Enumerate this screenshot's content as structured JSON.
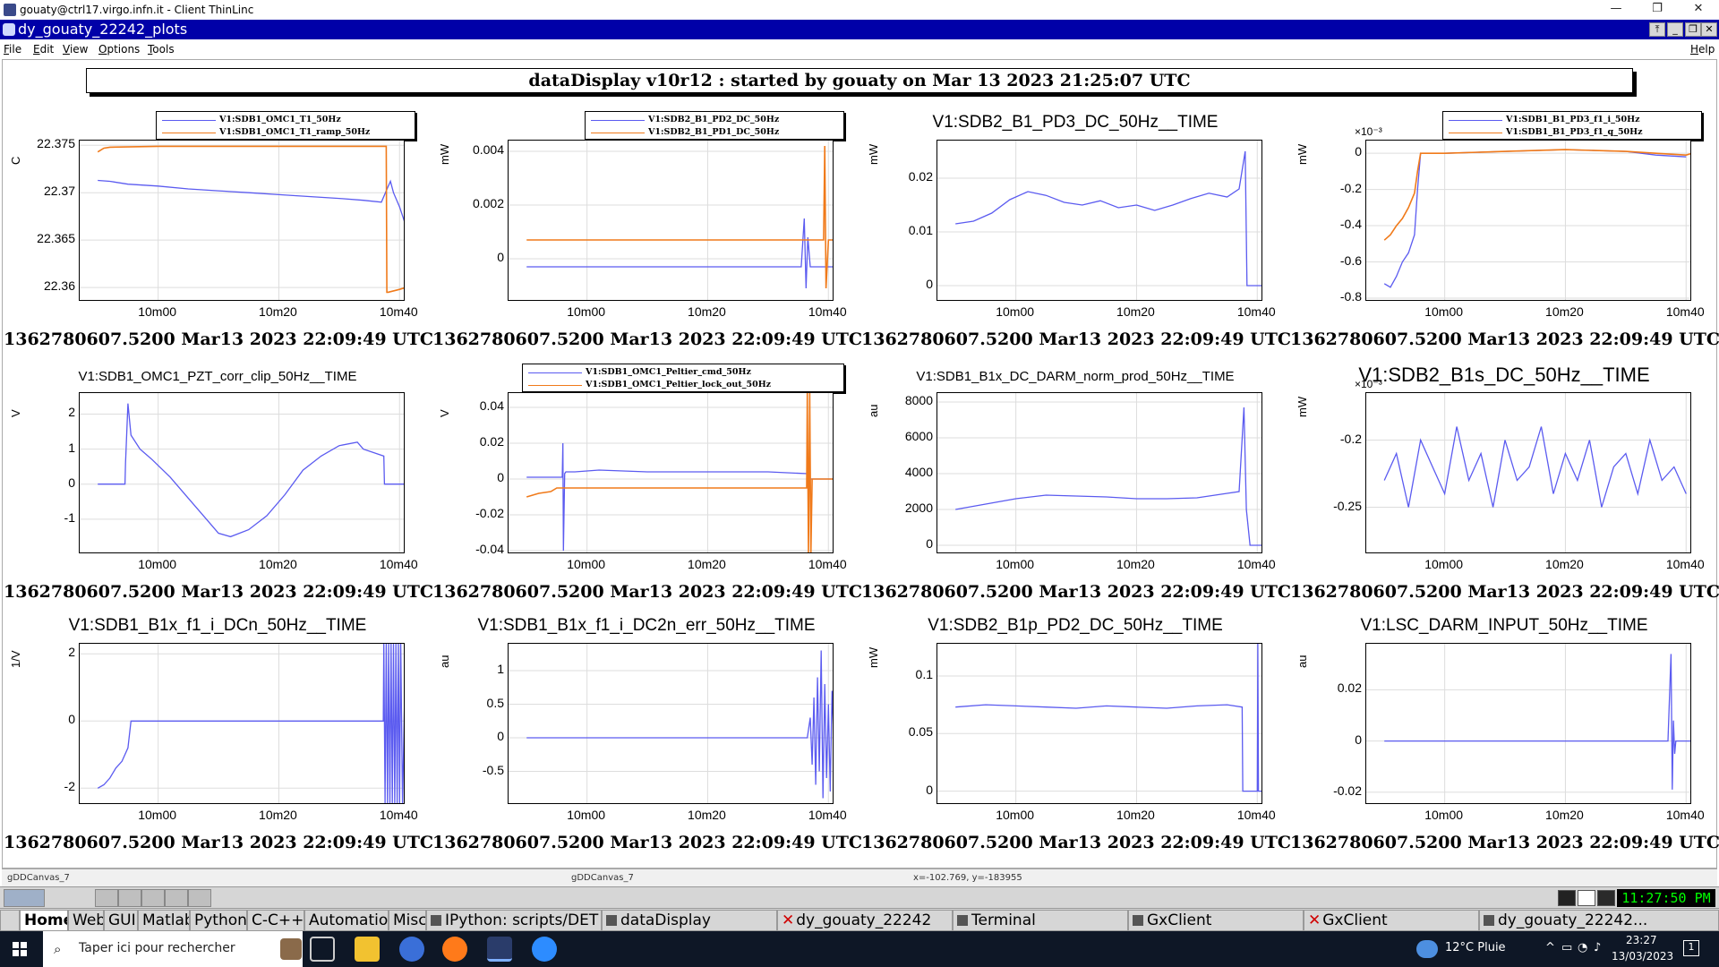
{
  "window": {
    "os_title": "gouaty@ctrl17.virgo.infn.it - Client ThinLinc",
    "app_title": "dy_gouaty_22242_plots",
    "minimize_label": "—",
    "restore_label": "❐",
    "close_label": "✕"
  },
  "menubar": {
    "file": "File",
    "edit": "Edit",
    "view": "View",
    "options": "Options",
    "tools": "Tools",
    "help": "Help"
  },
  "header": "dataDisplay v10r12 : started by gouaty on Mar 13 2023 21:25:07 UTC",
  "timestamp": "1362780607.5200 Mar13 2023 22:09:49 UTC",
  "x_ticks": [
    "10m00",
    "10m20",
    "10m40"
  ],
  "colors": {
    "blue": "#5b5bf0",
    "orange": "#f07a1a"
  },
  "chart_data": [
    {
      "type": "line",
      "legend": [
        "V1:SDB1_OMC1_T1_50Hz",
        "V1:SDB1_OMC1_T1_ramp_50Hz"
      ],
      "ylabel": "C",
      "ylim": [
        22.3585,
        22.3755
      ],
      "yticks": [
        "22.375",
        "22.37",
        "22.365",
        "22.36"
      ],
      "ytick_values": [
        22.375,
        22.37,
        22.365,
        22.36
      ],
      "series": [
        {
          "name": "V1:SDB1_OMC1_T1_50Hz",
          "color": "blue",
          "x": [
            0,
            2,
            5,
            10,
            15,
            20,
            25,
            30,
            35,
            40,
            44,
            47,
            48,
            48.5,
            49,
            50,
            51
          ],
          "y": [
            22.3713,
            22.3712,
            22.3709,
            22.3707,
            22.3704,
            22.3702,
            22.37,
            22.3698,
            22.3696,
            22.3694,
            22.3692,
            22.369,
            22.3705,
            22.3712,
            22.37,
            22.3685,
            22.3666
          ]
        },
        {
          "name": "V1:SDB1_OMC1_T1_ramp_50Hz",
          "color": "orange",
          "x": [
            0,
            1,
            2,
            10,
            20,
            30,
            40,
            47.8,
            47.9,
            48.1,
            50,
            51
          ],
          "y": [
            22.3743,
            22.3747,
            22.3748,
            22.3749,
            22.3749,
            22.3749,
            22.3749,
            22.3749,
            22.3595,
            22.3595,
            22.3598,
            22.36
          ]
        }
      ]
    },
    {
      "type": "line",
      "legend": [
        "V1:SDB2_B1_PD2_DC_50Hz",
        "V1:SDB2_B1_PD1_DC_50Hz"
      ],
      "ylabel": "mW",
      "ylim": [
        -0.0016,
        0.0044
      ],
      "yticks": [
        "0.004",
        "0.002",
        "0"
      ],
      "ytick_values": [
        0.004,
        0.002,
        0
      ],
      "series": [
        {
          "name": "V1:SDB2_B1_PD2_DC_50Hz",
          "color": "blue",
          "x": [
            0,
            10,
            20,
            30,
            40,
            45.5,
            46,
            46.3,
            46.6,
            47,
            49,
            51
          ],
          "y": [
            -0.0003,
            -0.0003,
            -0.0003,
            -0.0003,
            -0.0003,
            -0.0003,
            0.0015,
            -0.0011,
            0.0008,
            -0.0003,
            -0.0003,
            -0.0003
          ]
        },
        {
          "name": "V1:SDB2_B1_PD1_DC_50Hz",
          "color": "orange",
          "x": [
            0,
            10,
            20,
            30,
            40,
            48,
            49.2,
            49.4,
            49.6,
            50,
            51
          ],
          "y": [
            0.0007,
            0.0007,
            0.0007,
            0.0007,
            0.0007,
            0.0007,
            0.0007,
            0.0042,
            -0.0011,
            0.0007,
            0.0007
          ]
        }
      ]
    },
    {
      "type": "line",
      "title": "V1:SDB2_B1_PD3_DC_50Hz__TIME",
      "ylabel": "mW",
      "ylim": [
        -0.003,
        0.027
      ],
      "yticks": [
        "0.02",
        "0.01",
        "0"
      ],
      "ytick_values": [
        0.02,
        0.01,
        0
      ],
      "series": [
        {
          "color": "blue",
          "x": [
            0,
            3,
            6,
            9,
            12,
            15,
            18,
            21,
            24,
            27,
            30,
            33,
            36,
            39,
            42,
            45,
            47,
            48,
            48.3,
            48.6,
            51
          ],
          "y": [
            0.0115,
            0.012,
            0.0135,
            0.016,
            0.0175,
            0.0168,
            0.0155,
            0.015,
            0.0158,
            0.0145,
            0.015,
            0.014,
            0.015,
            0.0162,
            0.0172,
            0.0165,
            0.018,
            0.025,
            0.0,
            0.0,
            0.0
          ]
        }
      ]
    },
    {
      "type": "line",
      "legend": [
        "V1:SDB1_B1_PD3_f1_i_50Hz",
        "V1:SDB1_B1_PD3_f1_q_50Hz"
      ],
      "ylabel": "mW",
      "exponent": "×10⁻³",
      "ylim": [
        -0.82,
        0.07
      ],
      "yticks": [
        "0",
        "-0.2",
        "-0.4",
        "-0.6",
        "-0.8"
      ],
      "ytick_values": [
        0,
        -0.2,
        -0.4,
        -0.6,
        -0.8
      ],
      "series": [
        {
          "name": "V1:SDB1_B1_PD3_f1_i_50Hz",
          "color": "blue",
          "x": [
            0,
            1,
            2,
            3,
            4,
            5,
            5.5,
            6,
            10,
            20,
            30,
            40,
            45,
            50
          ],
          "y": [
            -0.72,
            -0.74,
            -0.68,
            -0.6,
            -0.55,
            -0.45,
            -0.2,
            0.0,
            0.0,
            0.01,
            0.02,
            0.01,
            -0.01,
            -0.02
          ]
        },
        {
          "name": "V1:SDB1_B1_PD3_f1_q_50Hz",
          "color": "orange",
          "x": [
            0,
            1,
            2,
            3,
            4,
            5,
            5.5,
            6,
            10,
            20,
            30,
            40,
            45,
            50,
            51
          ],
          "y": [
            -0.48,
            -0.45,
            -0.4,
            -0.36,
            -0.3,
            -0.22,
            -0.1,
            0.0,
            0.0,
            0.01,
            0.02,
            0.01,
            0.0,
            -0.01,
            0.0
          ]
        }
      ]
    },
    {
      "type": "line",
      "title": "V1:SDB1_OMC1_PZT_corr_clip_50Hz__TIME",
      "ylabel": "V",
      "ylim": [
        -2.0,
        2.6
      ],
      "yticks": [
        "2",
        "1",
        "0",
        "-1"
      ],
      "ytick_values": [
        2,
        1,
        0,
        -1
      ],
      "series": [
        {
          "color": "blue",
          "x": [
            0,
            4.5,
            4.6,
            5,
            5.5,
            7,
            9,
            12,
            15,
            18,
            20,
            22,
            25,
            28,
            31,
            34,
            37,
            40,
            43,
            44,
            47.4,
            47.5,
            51
          ],
          "y": [
            0,
            0,
            0.6,
            2.3,
            1.4,
            1.0,
            0.7,
            0.2,
            -0.4,
            -1.0,
            -1.4,
            -1.5,
            -1.3,
            -0.9,
            -0.3,
            0.4,
            0.8,
            1.1,
            1.2,
            1.0,
            0.8,
            0,
            0
          ]
        }
      ]
    },
    {
      "type": "line",
      "legend": [
        "V1:SDB1_OMC1_Peltier_cmd_50Hz",
        "V1:SDB1_OMC1_Peltier_lock_out_50Hz"
      ],
      "ylabel": "V",
      "ylim": [
        -0.042,
        0.048
      ],
      "yticks": [
        "0.04",
        "0.02",
        "0",
        "-0.02",
        "-0.04"
      ],
      "ytick_values": [
        0.04,
        0.02,
        0,
        -0.02,
        -0.04
      ],
      "series": [
        {
          "name": "V1:SDB1_OMC1_Peltier_cmd_50Hz",
          "color": "blue",
          "x": [
            0,
            3,
            5.9,
            6,
            6.1,
            6.3,
            6.5,
            8,
            12,
            20,
            30,
            40,
            46.5,
            47,
            51
          ],
          "y": [
            0.001,
            0.001,
            0.001,
            0.02,
            -0.04,
            0.003,
            0.004,
            0.004,
            0.005,
            0.004,
            0.004,
            0.004,
            0.003,
            0.0,
            0.0
          ]
        },
        {
          "name": "V1:SDB1_OMC1_Peltier_lock_out_50Hz",
          "color": "orange",
          "x": [
            0,
            2,
            4,
            5,
            5.2,
            10,
            20,
            30,
            40,
            46.4,
            46.5,
            46.7,
            46.9,
            47.1,
            47.3,
            51
          ],
          "y": [
            -0.01,
            -0.008,
            -0.007,
            -0.005,
            -0.005,
            -0.005,
            -0.005,
            -0.005,
            -0.005,
            -0.005,
            0.048,
            -0.042,
            0.048,
            -0.042,
            0.0,
            0.0
          ]
        }
      ]
    },
    {
      "type": "line",
      "title": "V1:SDB1_B1x_DC_DARM_norm_prod_50Hz__TIME",
      "ylabel": "au",
      "ylim": [
        -500,
        8500
      ],
      "yticks": [
        "8000",
        "6000",
        "4000",
        "2000",
        "0"
      ],
      "ytick_values": [
        8000,
        6000,
        4000,
        2000,
        0
      ],
      "series": [
        {
          "color": "blue",
          "x": [
            0,
            5,
            10,
            15,
            20,
            25,
            30,
            35,
            40,
            45,
            47,
            47.8,
            48.2,
            48.8,
            51
          ],
          "y": [
            2000,
            2300,
            2600,
            2800,
            2750,
            2700,
            2600,
            2600,
            2650,
            2900,
            3000,
            7700,
            2000,
            0,
            0
          ]
        }
      ]
    },
    {
      "type": "line",
      "title": "V1:SDB2_B1s_DC_50Hz__TIME",
      "ylabel": "mW",
      "exponent": "×10⁻³",
      "ylim": [
        -0.285,
        -0.165
      ],
      "yticks": [
        "-0.2",
        "-0.25"
      ],
      "ytick_values": [
        -0.2,
        -0.25
      ],
      "series": [
        {
          "color": "blue",
          "x": [
            0,
            2,
            4,
            6,
            8,
            10,
            12,
            14,
            16,
            18,
            20,
            22,
            24,
            26,
            28,
            30,
            32,
            34,
            36,
            38,
            40,
            42,
            44,
            46,
            48,
            50
          ],
          "y": [
            -0.23,
            -0.21,
            -0.25,
            -0.2,
            -0.22,
            -0.24,
            -0.19,
            -0.23,
            -0.21,
            -0.25,
            -0.2,
            -0.23,
            -0.22,
            -0.19,
            -0.24,
            -0.21,
            -0.23,
            -0.2,
            -0.25,
            -0.22,
            -0.21,
            -0.24,
            -0.2,
            -0.23,
            -0.22,
            -0.24
          ]
        }
      ]
    },
    {
      "type": "line",
      "title": "V1:SDB1_B1x_f1_i_DCn_50Hz__TIME",
      "ylabel": "1/V",
      "ylim": [
        -2.5,
        2.3
      ],
      "yticks": [
        "2",
        "0",
        "-2"
      ],
      "ytick_values": [
        2,
        0,
        -2
      ],
      "series": [
        {
          "color": "blue",
          "x": [
            0,
            1,
            2,
            3,
            4,
            5,
            5.5,
            6,
            10,
            20,
            30,
            40,
            47.3,
            47.4,
            47.6,
            47.8,
            48,
            48.2,
            48.4,
            48.6,
            48.8,
            49,
            49.2,
            49.4,
            49.6,
            49.8,
            50,
            50.2,
            50.5,
            51
          ],
          "y": [
            -2.0,
            -1.9,
            -1.7,
            -1.4,
            -1.2,
            -0.8,
            0.0,
            0.0,
            0.0,
            0.0,
            0.0,
            0.0,
            0.0,
            2.3,
            -2.5,
            2.3,
            -2.5,
            2.3,
            -2.5,
            2.3,
            -2.5,
            2.3,
            -2.5,
            2.3,
            -2.5,
            2.3,
            -2.5,
            2.3,
            -2.5,
            2.3
          ]
        }
      ]
    },
    {
      "type": "line",
      "title": "V1:SDB1_B1x_f1_i_DC2n_err_50Hz__TIME",
      "ylabel": "au",
      "ylim": [
        -1.0,
        1.4
      ],
      "yticks": [
        "1",
        "0.5",
        "0",
        "-0.5"
      ],
      "ytick_values": [
        1,
        0.5,
        0,
        -0.5
      ],
      "series": [
        {
          "color": "blue",
          "x": [
            0,
            10,
            20,
            30,
            40,
            46.5,
            47,
            47.3,
            47.6,
            47.9,
            48.2,
            48.5,
            48.8,
            49.1,
            49.4,
            49.7,
            50,
            50.3,
            50.6,
            51
          ],
          "y": [
            0,
            0,
            0,
            0,
            0,
            0,
            0.3,
            -0.4,
            0.6,
            -0.7,
            0.9,
            -0.5,
            1.3,
            -0.9,
            0.8,
            -0.6,
            0.5,
            -0.8,
            0.7,
            -0.3
          ]
        }
      ]
    },
    {
      "type": "line",
      "title": "V1:SDB2_B1p_PD2_DC_50Hz__TIME",
      "ylabel": "mW",
      "ylim": [
        -0.012,
        0.128
      ],
      "yticks": [
        "0.1",
        "0.05",
        "0"
      ],
      "ytick_values": [
        0.1,
        0.05,
        0
      ],
      "series": [
        {
          "color": "blue",
          "x": [
            0,
            5,
            10,
            15,
            20,
            25,
            30,
            35,
            40,
            45,
            47.5,
            47.6,
            48,
            50,
            50.1,
            50.2,
            51
          ],
          "y": [
            0.073,
            0.075,
            0.074,
            0.073,
            0.072,
            0.074,
            0.073,
            0.072,
            0.074,
            0.075,
            0.073,
            0.0,
            0.0,
            0.0,
            0.128,
            0.0,
            0.0
          ]
        }
      ]
    },
    {
      "type": "line",
      "title": "V1:LSC_DARM_INPUT_50Hz__TIME",
      "ylabel": "au",
      "ylim": [
        -0.025,
        0.038
      ],
      "yticks": [
        "0.02",
        "0",
        "-0.02"
      ],
      "ytick_values": [
        0.02,
        0,
        -0.02
      ],
      "series": [
        {
          "color": "blue",
          "x": [
            0,
            10,
            20,
            30,
            40,
            47,
            47.5,
            47.7,
            47.9,
            48.1,
            48.3,
            49,
            51
          ],
          "y": [
            0,
            0,
            0,
            0,
            0,
            0,
            0.034,
            -0.019,
            0.008,
            -0.005,
            0,
            0,
            0
          ]
        }
      ]
    }
  ],
  "status": {
    "left": "gDDCanvas_7",
    "mid": "gDDCanvas_7",
    "right": "x=-102.769, y=-183955"
  },
  "wm": {
    "clock": "11:27:50 PM"
  },
  "tasks": [
    {
      "label": "Home",
      "active": true
    },
    {
      "label": "Web"
    },
    {
      "label": "GUI"
    },
    {
      "label": "Matlab"
    },
    {
      "label": "Python"
    },
    {
      "label": "C-C++"
    },
    {
      "label": "Automation"
    },
    {
      "label": "Misc"
    },
    {
      "label": "IPython: scripts/DET"
    },
    {
      "label": "dataDisplay"
    },
    {
      "label": "dy_gouaty_22242"
    },
    {
      "label": "Terminal"
    },
    {
      "label": "GxClient"
    },
    {
      "label": "GxClient"
    },
    {
      "label": "dy_gouaty_22242..."
    }
  ],
  "win": {
    "search_placeholder": "Taper ici pour rechercher",
    "weather": "12°C  Pluie",
    "time": "23:27",
    "date": "13/03/2023",
    "notif": "1"
  }
}
